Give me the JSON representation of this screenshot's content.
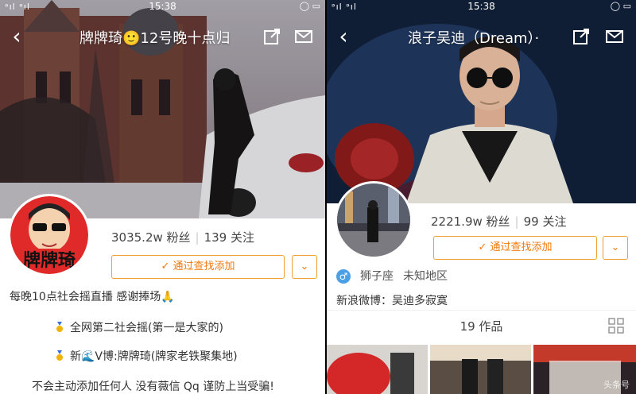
{
  "status": {
    "signal": "ᵊıl ᵊıl",
    "time": "15:38"
  },
  "left": {
    "title": "牌牌琦🙂12号晚十点归",
    "avatar_text": "牌牌琦",
    "fans": "3035.2w 粉丝",
    "follow": "139 关注",
    "add_button": "通过查找添加",
    "bio": [
      "每晚10点社会摇直播 感谢捧场🙏",
      "全网第二社会摇(第一是大家的)",
      "新🌊V博:牌牌琦(牌家老铁聚集地)",
      "不会主动添加任何人 没有薇信 Qq 谨防上当受骗!"
    ]
  },
  "right": {
    "title": "浪子吴迪（Dream）·",
    "fans": "2221.9w 粉丝",
    "follow": "99 关注",
    "add_button": "通过查找添加",
    "gender_symbol": "♂",
    "zodiac": "狮子座",
    "location": "未知地区",
    "weibo": "新浪微博：吴迪多寂寞",
    "works": "19 作品",
    "watermark": "头条号"
  },
  "colors": {
    "accent": "#f07a10",
    "gender": "#4aa0e6"
  }
}
